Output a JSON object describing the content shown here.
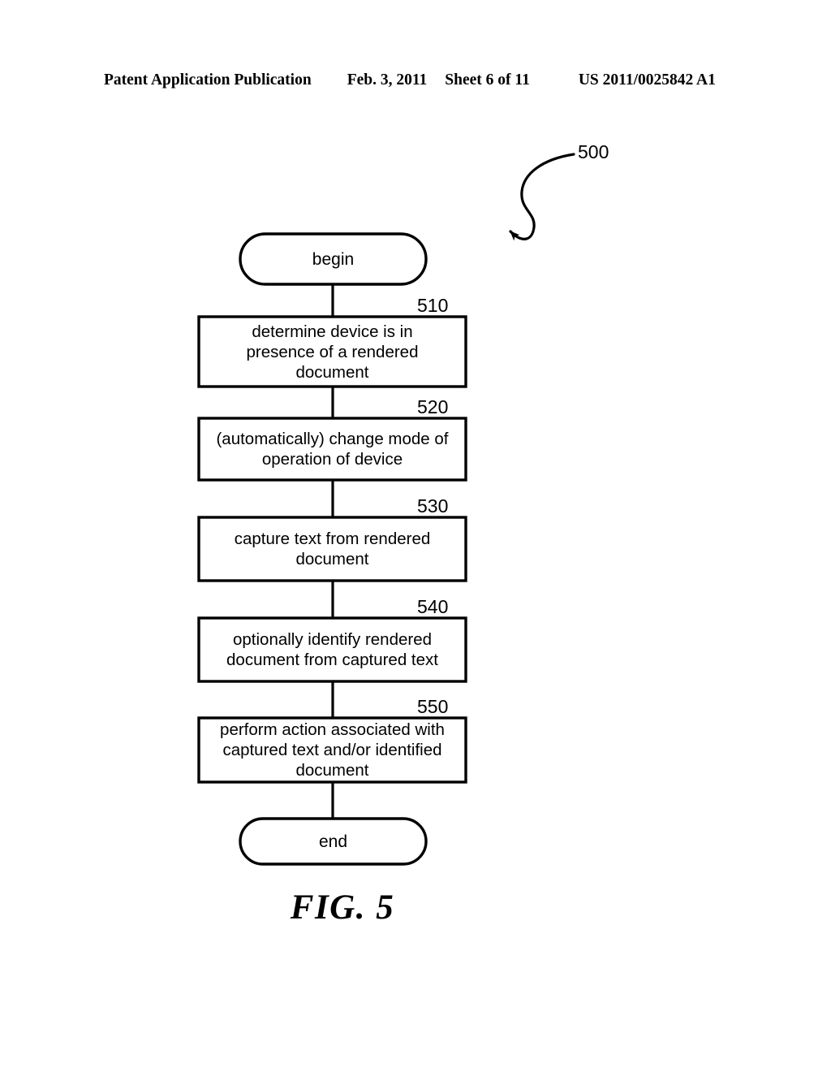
{
  "header": {
    "publication": "Patent Application Publication",
    "date": "Feb. 3, 2011",
    "sheet": "Sheet 6 of 11",
    "patent_number": "US 2011/0025842 A1"
  },
  "figure": {
    "caption": "FIG. 5",
    "diagram_label": "500",
    "diagram_label_name": "flowchart-reference-500"
  },
  "flowchart": {
    "type": "flowchart",
    "orientation": "vertical",
    "nodes": [
      {
        "id": "begin",
        "shape": "terminal",
        "label": "begin",
        "ref": null
      },
      {
        "id": "510",
        "shape": "process",
        "label": "determine device is in\npresence of a rendered\ndocument",
        "ref": "510"
      },
      {
        "id": "520",
        "shape": "process",
        "label": "(automatically) change mode of\noperation of device",
        "ref": "520"
      },
      {
        "id": "530",
        "shape": "process",
        "label": "capture text from rendered\ndocument",
        "ref": "530"
      },
      {
        "id": "540",
        "shape": "process",
        "label": "optionally identify rendered\ndocument from captured text",
        "ref": "540"
      },
      {
        "id": "550",
        "shape": "process",
        "label": "perform action associated with\ncaptured text and/or identified\ndocument",
        "ref": "550"
      },
      {
        "id": "end",
        "shape": "terminal",
        "label": "end",
        "ref": null
      }
    ],
    "edges": [
      {
        "from": "begin",
        "to": "510"
      },
      {
        "from": "510",
        "to": "520"
      },
      {
        "from": "520",
        "to": "530"
      },
      {
        "from": "530",
        "to": "540"
      },
      {
        "from": "540",
        "to": "550"
      },
      {
        "from": "550",
        "to": "end"
      }
    ]
  },
  "colors": {
    "ink": "#000000",
    "paper": "#ffffff"
  }
}
